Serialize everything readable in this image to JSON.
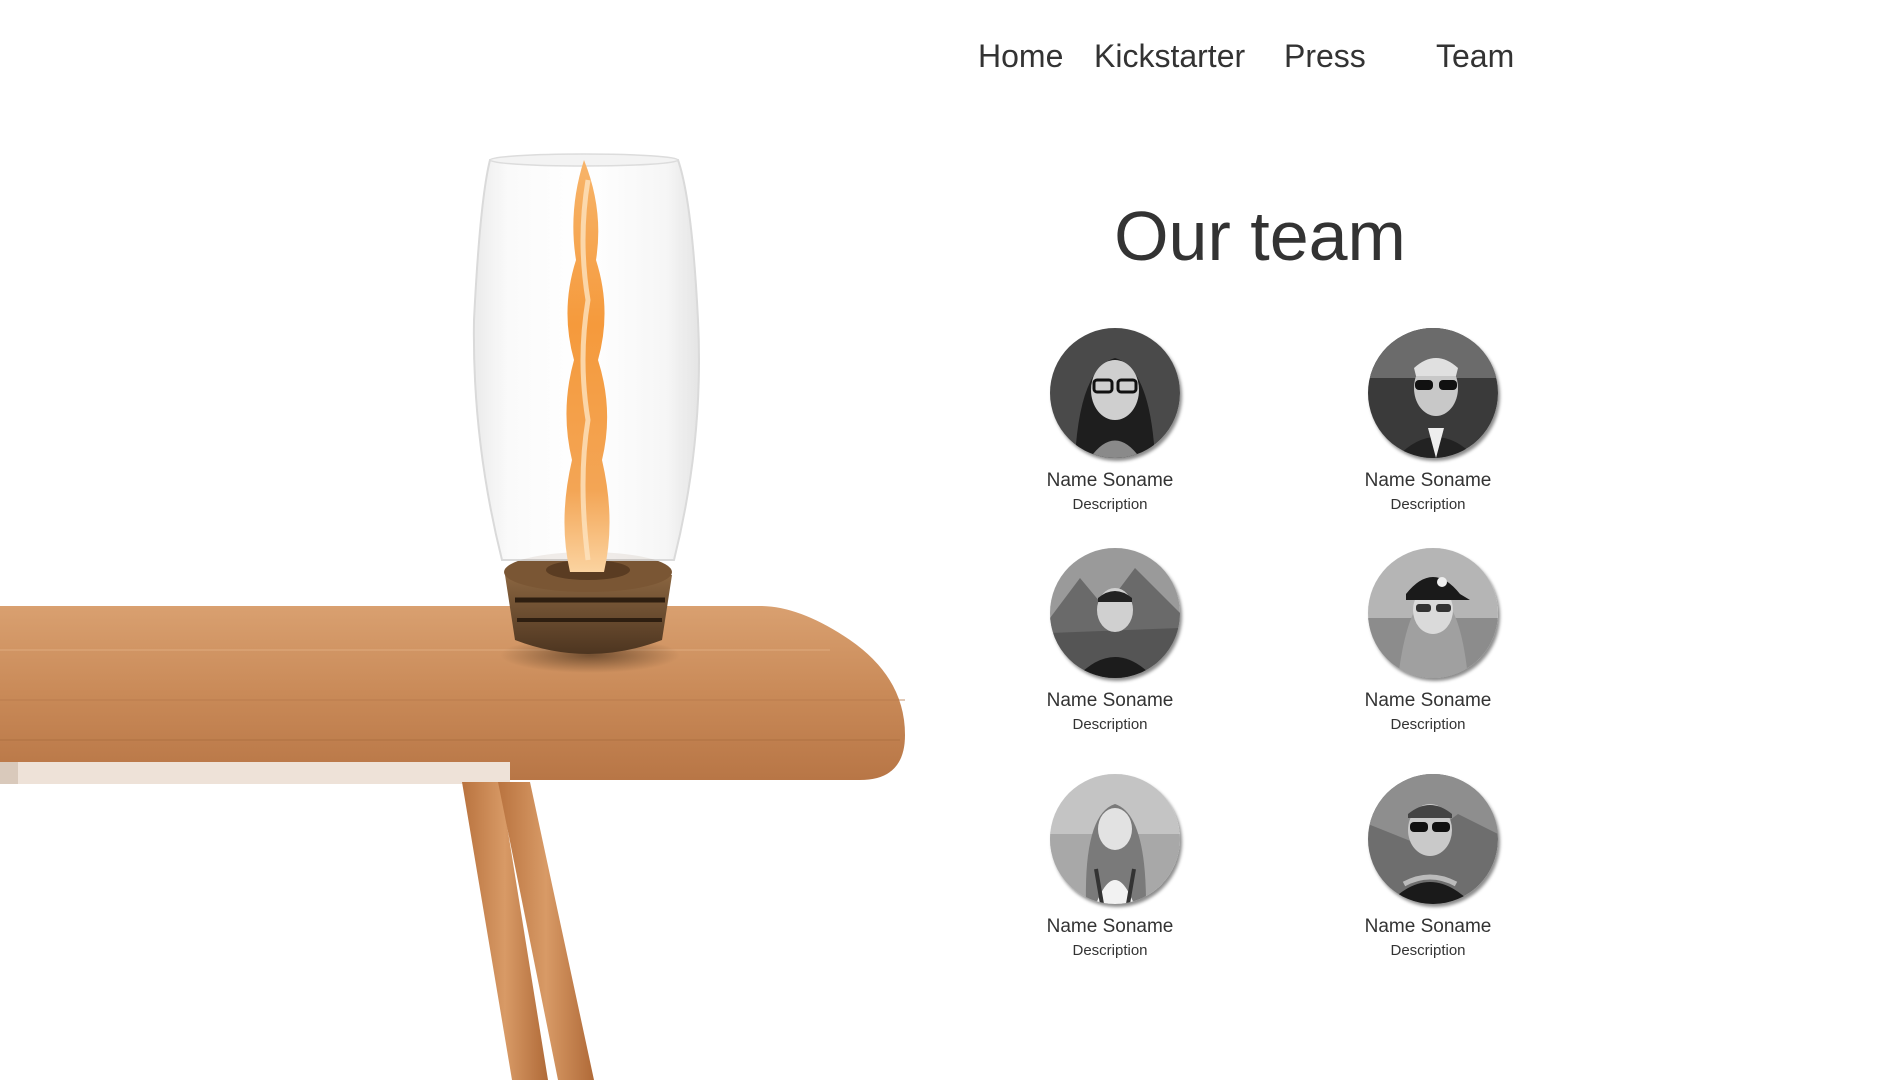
{
  "nav": {
    "items": [
      {
        "label": "Home"
      },
      {
        "label": "Kickstarter"
      },
      {
        "label": "Press"
      },
      {
        "label": "Team"
      }
    ]
  },
  "section": {
    "title": "Our team"
  },
  "team": [
    {
      "name": "Name Soname",
      "description": "Description",
      "avatar_icon": "woman-with-glasses-portrait"
    },
    {
      "name": "Name Soname",
      "description": "Description",
      "avatar_icon": "man-with-sunglasses-portrait"
    },
    {
      "name": "Name Soname",
      "description": "Description",
      "avatar_icon": "man-mountain-background-portrait"
    },
    {
      "name": "Name Soname",
      "description": "Description",
      "avatar_icon": "woman-with-cap-portrait"
    },
    {
      "name": "Name Soname",
      "description": "Description",
      "avatar_icon": "woman-long-hair-portrait"
    },
    {
      "name": "Name Soname",
      "description": "Description",
      "avatar_icon": "man-with-sunglasses-outdoor-portrait"
    }
  ],
  "hero": {
    "image_icon": "fire-lamp-on-wooden-table"
  },
  "colors": {
    "text": "#333333",
    "background": "#ffffff",
    "wood": "#c98a58",
    "flame": "#f59a3c"
  }
}
